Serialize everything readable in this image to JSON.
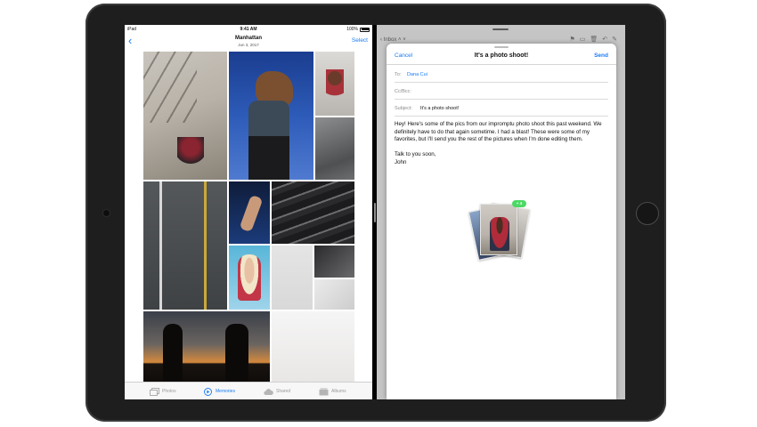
{
  "status_bar": {
    "carrier": "iPad",
    "time": "9:41 AM",
    "battery": "100%"
  },
  "photos": {
    "nav": {
      "title": "Manhattan",
      "subtitle": "Jun 3, 2017",
      "select_label": "Select"
    },
    "tabs": [
      {
        "label": "Photos",
        "icon": "photos-tab-icon",
        "active": false
      },
      {
        "label": "Memories",
        "icon": "memories-tab-icon",
        "active": true
      },
      {
        "label": "Shared",
        "icon": "cloud-shared-icon",
        "active": false
      },
      {
        "label": "Albums",
        "icon": "albums-tab-icon",
        "active": false
      }
    ]
  },
  "mail_background": {
    "back_label": "Inbox",
    "toolbar_icons": [
      "flag-icon",
      "folder-icon",
      "trash-icon",
      "reply-icon",
      "compose-icon"
    ]
  },
  "compose": {
    "cancel_label": "Cancel",
    "title": "It's a photo shoot!",
    "send_label": "Send",
    "to_label": "To:",
    "to_value": "Dana Cui",
    "cc_label": "Cc/Bcc:",
    "subject_label": "Subject:",
    "subject_value": "It's a photo shoot!",
    "body_paragraph_1": "Hey! Here's some of the pics from our impromptu photo shoot this past weekend. We definitely have to do that again sometime. I had a blast! These were some of my favorites, but I'll send you the rest of the pictures when I'm done editing them.",
    "body_signoff": "Talk to you soon,",
    "body_name": "John",
    "attachment_badge": "+ 4"
  },
  "colors": {
    "accent": "#1a7cf5",
    "badge": "#4cd964",
    "device": "#1e1e1f"
  }
}
